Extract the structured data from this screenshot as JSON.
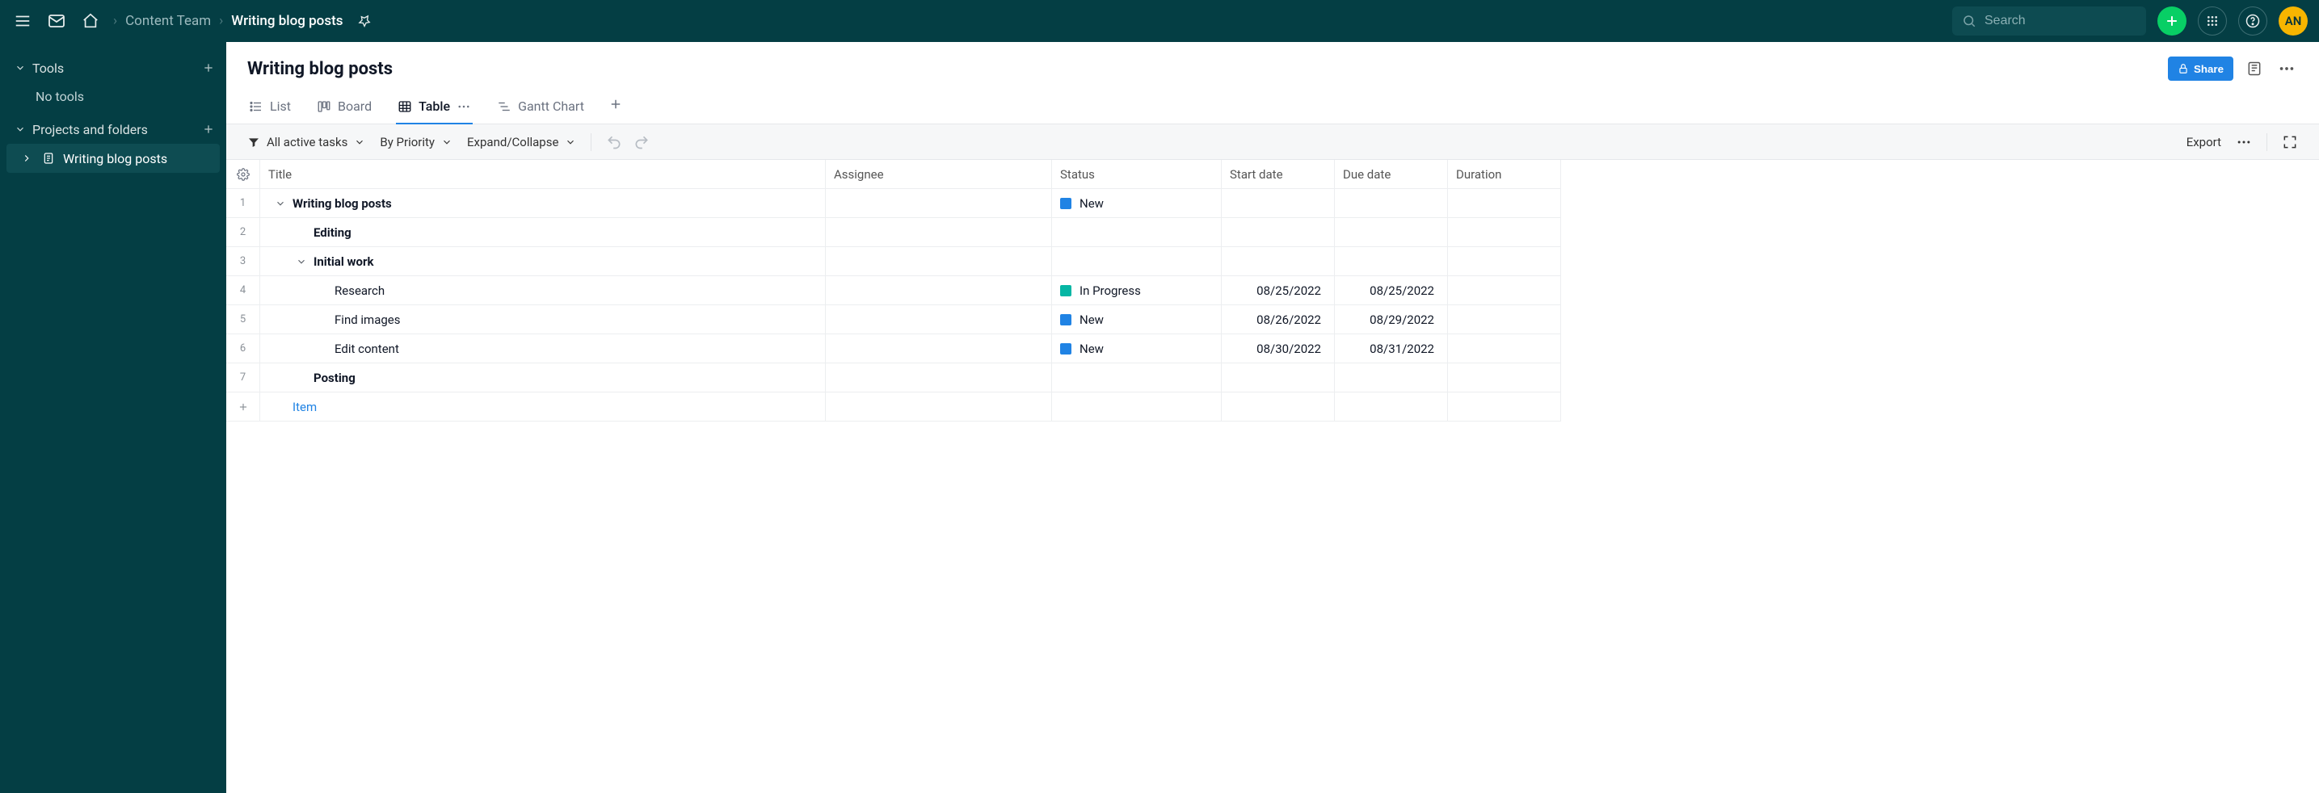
{
  "topbar": {
    "search_placeholder": "Search",
    "avatar_initials": "AN"
  },
  "breadcrumbs": {
    "parent": "Content Team",
    "current": "Writing blog posts"
  },
  "sidebar": {
    "tools_label": "Tools",
    "tools_empty": "No tools",
    "projects_label": "Projects and folders",
    "project_item": "Writing blog posts"
  },
  "page": {
    "title": "Writing blog posts",
    "share_label": "Share"
  },
  "tabs": {
    "list": "List",
    "board": "Board",
    "table": "Table",
    "gantt": "Gantt Chart"
  },
  "toolbar": {
    "filter_label": "All active tasks",
    "sort_label": "By Priority",
    "expand_label": "Expand/Collapse",
    "export_label": "Export"
  },
  "columns": {
    "title": "Title",
    "assignee": "Assignee",
    "status": "Status",
    "start": "Start date",
    "due": "Due date",
    "duration": "Duration"
  },
  "status_colors": {
    "new": "#2083e4",
    "in_progress": "#06b6a4"
  },
  "rows": [
    {
      "n": "1",
      "title": "Writing blog posts",
      "indent": 0,
      "bold": true,
      "caret": "down",
      "status": "New",
      "status_key": "new",
      "start": "",
      "due": ""
    },
    {
      "n": "2",
      "title": "Editing",
      "indent": 1,
      "bold": true,
      "caret": "",
      "status": "",
      "status_key": "",
      "start": "",
      "due": ""
    },
    {
      "n": "3",
      "title": "Initial work",
      "indent": 1,
      "bold": true,
      "caret": "down",
      "status": "",
      "status_key": "",
      "start": "",
      "due": ""
    },
    {
      "n": "4",
      "title": "Research",
      "indent": 2,
      "bold": false,
      "caret": "",
      "status": "In Progress",
      "status_key": "in_progress",
      "start": "08/25/2022",
      "due": "08/25/2022"
    },
    {
      "n": "5",
      "title": "Find images",
      "indent": 2,
      "bold": false,
      "caret": "",
      "status": "New",
      "status_key": "new",
      "start": "08/26/2022",
      "due": "08/29/2022"
    },
    {
      "n": "6",
      "title": "Edit content",
      "indent": 2,
      "bold": false,
      "caret": "",
      "status": "New",
      "status_key": "new",
      "start": "08/30/2022",
      "due": "08/31/2022"
    },
    {
      "n": "7",
      "title": "Posting",
      "indent": 1,
      "bold": true,
      "caret": "",
      "status": "",
      "status_key": "",
      "start": "",
      "due": ""
    }
  ],
  "new_item_label": "Item"
}
